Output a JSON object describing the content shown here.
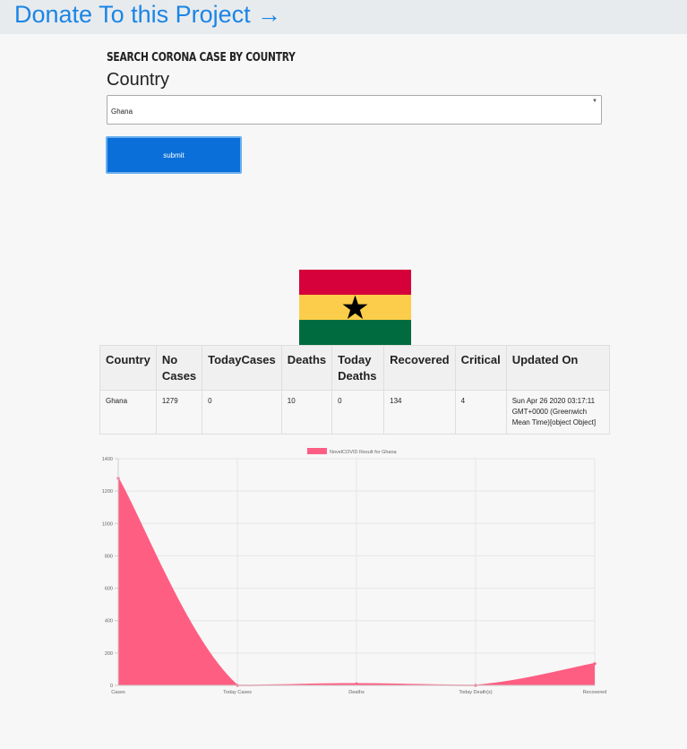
{
  "header": {
    "donate_label": "Donate To this Project →"
  },
  "search": {
    "title": "SEARCH CORONA CASE BY COUNTRY",
    "country_label": "Country",
    "selected_country": "Ghana",
    "submit_label": "submit"
  },
  "flag": {
    "icon": "ghana-flag-icon",
    "colors": [
      "#d6003a",
      "#fccd4b",
      "#006b3f"
    ],
    "star_color": "#000000"
  },
  "table": {
    "headers": [
      "Country",
      "No Cases",
      "TodayCases",
      "Deaths",
      "Today Deaths",
      "Recovered",
      "Critical",
      "Updated On"
    ],
    "row": [
      "Ghana",
      "1279",
      "0",
      "10",
      "0",
      "134",
      "4",
      "Sun Apr 26 2020 03:17:11 GMT+0000 (Greenwich Mean Time)[object Object]"
    ]
  },
  "chart_data": {
    "type": "area",
    "legend": "NovelCOVID Result for Ghana",
    "categories": [
      "Cases",
      "Today Cases",
      "Deaths",
      "Today Death(s)",
      "Recovered"
    ],
    "series": [
      {
        "name": "NovelCOVID Result for Ghana",
        "values": [
          1279,
          0,
          10,
          0,
          134
        ],
        "color": "#ff5e83"
      }
    ],
    "ylim": [
      0,
      1400
    ],
    "yticks": [
      0,
      200,
      400,
      600,
      800,
      1000,
      1200,
      1400
    ],
    "grid": true,
    "legend_position": "top"
  }
}
